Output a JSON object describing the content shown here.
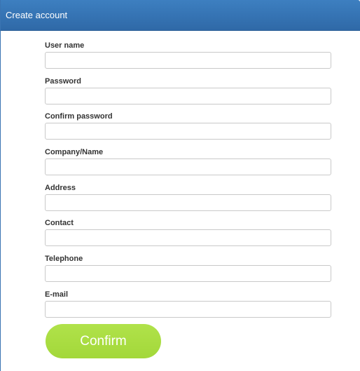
{
  "header": {
    "title": "Create account"
  },
  "form": {
    "fields": [
      {
        "label": "User name",
        "value": ""
      },
      {
        "label": "Password",
        "value": ""
      },
      {
        "label": "Confirm password",
        "value": ""
      },
      {
        "label": "Company/Name",
        "value": ""
      },
      {
        "label": "Address",
        "value": ""
      },
      {
        "label": "Contact",
        "value": ""
      },
      {
        "label": "Telephone",
        "value": ""
      },
      {
        "label": "E-mail",
        "value": ""
      }
    ],
    "confirm_label": "Confirm"
  },
  "colors": {
    "header_blue": "#3573b3",
    "confirm_green": "#a3d83a"
  }
}
